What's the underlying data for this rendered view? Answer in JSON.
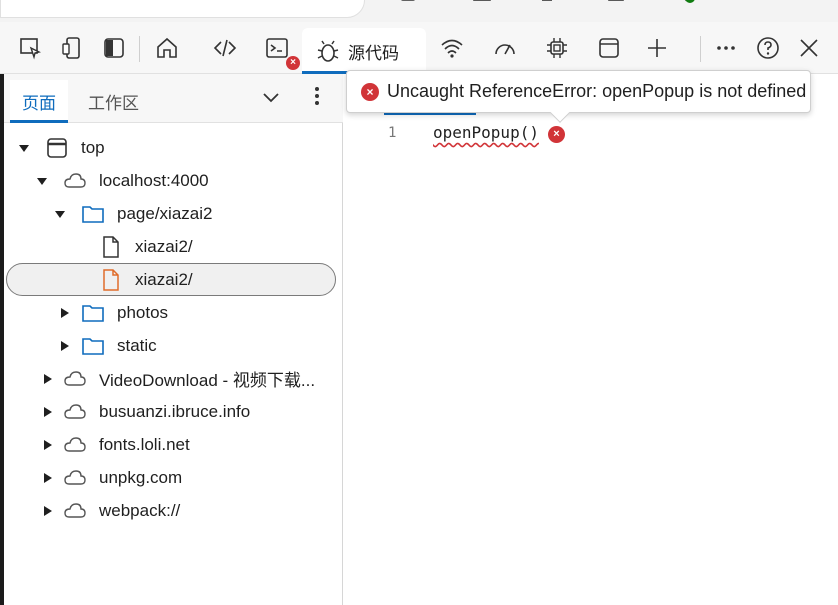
{
  "toolbar": {
    "active_tab_label": "源代码",
    "tools": [
      "inspect-icon",
      "device-emulation-icon",
      "sidebar-toggle-icon",
      "welcome-home-icon",
      "elements-icon",
      "console-icon",
      "network-icon",
      "performance-icon",
      "memory-icon",
      "application-icon",
      "add-tool-icon",
      "more-tools-icon",
      "help-icon",
      "close-icon"
    ],
    "console_error_badge": "×"
  },
  "navigator": {
    "tabs": [
      {
        "label": "页面",
        "active": true
      },
      {
        "label": "工作区",
        "active": false
      }
    ],
    "tree": [
      {
        "label": "top",
        "type": "frame",
        "expanded": true
      },
      {
        "label": "localhost:4000",
        "type": "origin",
        "expanded": true
      },
      {
        "label": "page/xiazai2",
        "type": "folder",
        "expanded": true
      },
      {
        "label": "xiazai2/",
        "type": "file",
        "selected": false
      },
      {
        "label": "xiazai2/",
        "type": "file",
        "selected": true
      },
      {
        "label": "photos",
        "type": "folder",
        "expanded": false
      },
      {
        "label": "static",
        "type": "folder",
        "expanded": false
      },
      {
        "label": "VideoDownload - 视频下载...",
        "type": "origin",
        "expanded": false
      },
      {
        "label": "busuanzi.ibruce.info",
        "type": "origin",
        "expanded": false
      },
      {
        "label": "fonts.loli.net",
        "type": "origin",
        "expanded": false
      },
      {
        "label": "unpkg.com",
        "type": "origin",
        "expanded": false
      },
      {
        "label": "webpack://",
        "type": "origin",
        "expanded": false
      }
    ]
  },
  "editor": {
    "line_number": "1",
    "code": "openPopup()",
    "error_tooltip": "Uncaught ReferenceError: openPopup is not defined",
    "error_marker": "×"
  },
  "colors": {
    "accent": "#0f6cbd",
    "error": "#d13438",
    "file_selected": "#e06c2a"
  }
}
